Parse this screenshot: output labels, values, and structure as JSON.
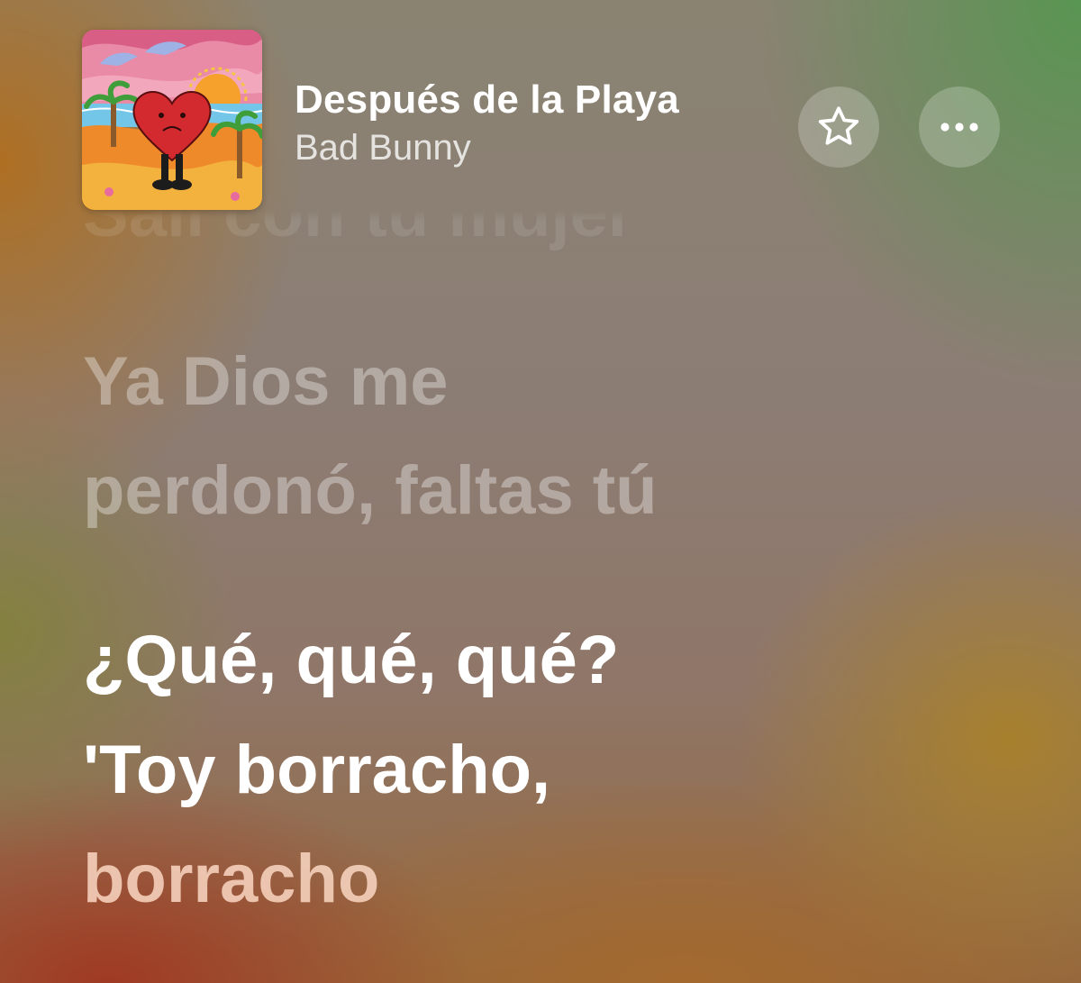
{
  "now_playing": {
    "title": "Después de la Playa",
    "artist": "Bad Bunny",
    "artwork_icon": "album-artwork-heart-beach"
  },
  "actions": {
    "favorite_icon": "star-icon",
    "more_icon": "ellipsis-icon"
  },
  "lyrics": {
    "faded_top": "Salí con tu mujer",
    "previous": [
      "Ya Dios me",
      "perdonó, faltas tú"
    ],
    "current": [
      "¿Qué, qué, qué?",
      "'Toy borracho,"
    ],
    "current_partial": "borracho"
  },
  "colors": {
    "accent_green": "#5f9650",
    "accent_orange": "#b06e1e",
    "accent_red": "#a0372a",
    "text_primary": "#ffffff"
  }
}
